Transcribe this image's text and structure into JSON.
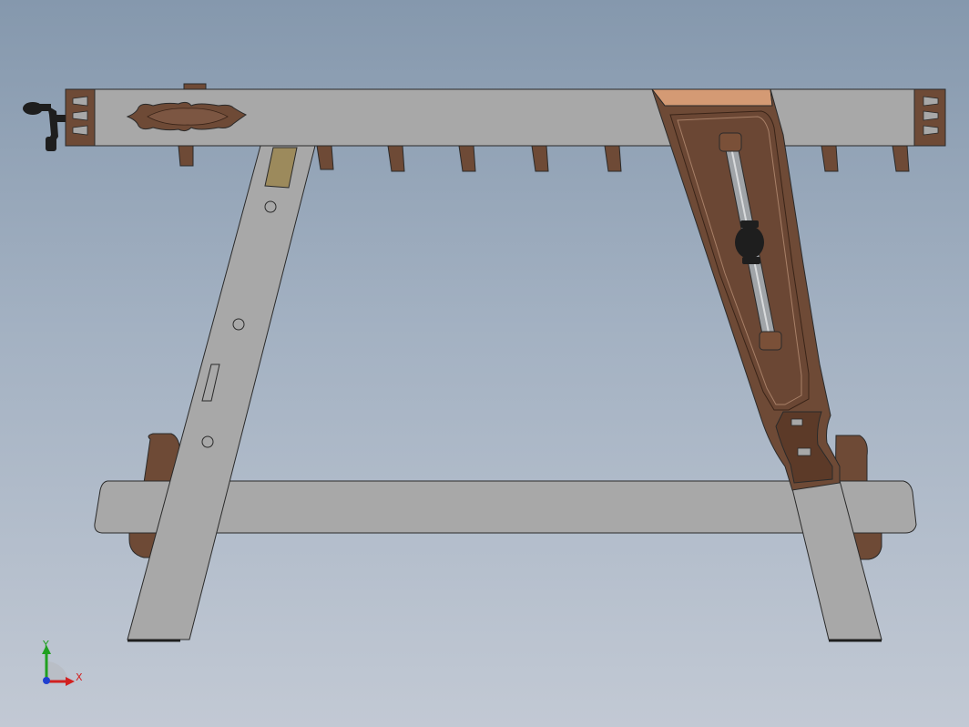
{
  "viewport": {
    "background_top": "#8598ad",
    "background_bottom": "#c2c9d4"
  },
  "model": {
    "description_icon": "workbench-sawhorse-model",
    "colors": {
      "steel": "#a8a8a8",
      "steel_dark": "#8f8f8f",
      "wood": "#6e4a36",
      "wood_dark": "#4e3223",
      "wood_light": "#d49a74",
      "tan": "#9c8a5c",
      "black": "#1e1e1e",
      "outline": "#2a2a2a"
    }
  },
  "triad": {
    "x_label": "X",
    "y_label": "Y",
    "x_color": "#d22020",
    "y_color": "#20a020",
    "z_color": "#2040d0"
  }
}
